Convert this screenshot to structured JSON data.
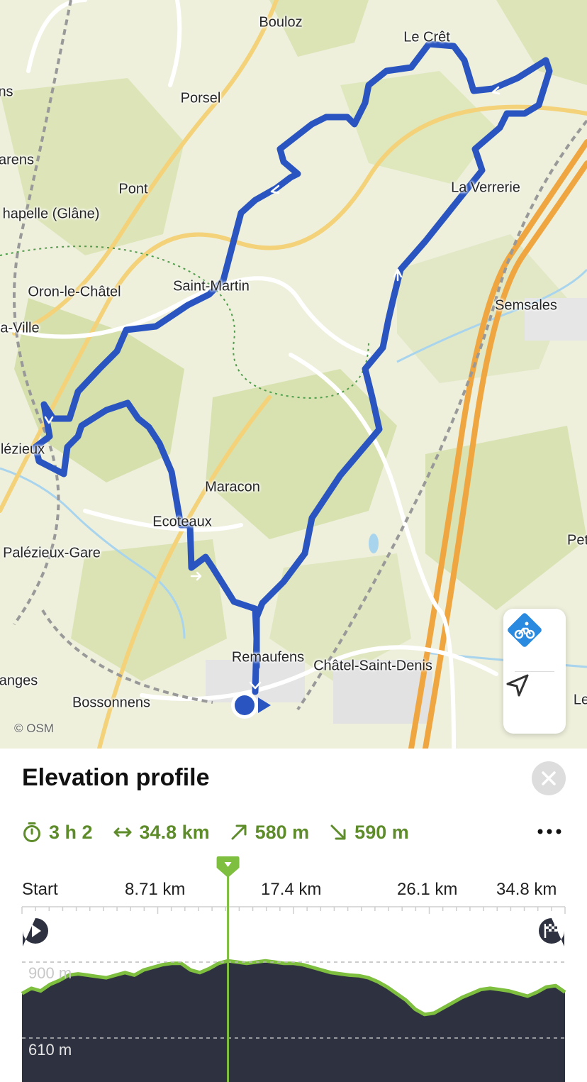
{
  "map": {
    "attribution": "© OSM",
    "places": [
      {
        "key": "bouloz",
        "label": "Bouloz"
      },
      {
        "key": "le-cret",
        "label": "Le Crêt"
      },
      {
        "key": "porsel",
        "label": "Porsel"
      },
      {
        "key": "ns",
        "label": "ns"
      },
      {
        "key": "arens",
        "label": "arens"
      },
      {
        "key": "pont",
        "label": "Pont"
      },
      {
        "key": "la-verrerie",
        "label": "La Verrerie"
      },
      {
        "key": "chapelle",
        "label": "hapelle (Glâne)"
      },
      {
        "key": "oron",
        "label": "Oron-le-Châtel"
      },
      {
        "key": "saint-martin",
        "label": "Saint-Martin"
      },
      {
        "key": "semsales",
        "label": "Semsales"
      },
      {
        "key": "ville",
        "label": "a-Ville"
      },
      {
        "key": "palezieux",
        "label": "lézieux"
      },
      {
        "key": "maracon",
        "label": "Maracon"
      },
      {
        "key": "ecoteaux",
        "label": "Ecoteaux"
      },
      {
        "key": "palezieux-gare",
        "label": "Palézieux-Gare"
      },
      {
        "key": "pet",
        "label": "Pet"
      },
      {
        "key": "remaufens",
        "label": "Remaufens"
      },
      {
        "key": "chatel",
        "label": "Châtel-Saint-Denis"
      },
      {
        "key": "anges",
        "label": "anges"
      },
      {
        "key": "bossonnens",
        "label": "Bossonnens"
      },
      {
        "key": "le",
        "label": "Le"
      }
    ],
    "controls": {
      "mode_icon": "bike-route-icon",
      "locate_icon": "location-arrow-icon"
    }
  },
  "panel": {
    "title": "Elevation profile",
    "stats": {
      "duration": "3 h 2",
      "distance": "34.8 km",
      "ascent": "580 m",
      "descent": "590 m"
    },
    "axis_labels": [
      "Start",
      "8.71 km",
      "17.4 km",
      "26.1 km",
      "34.8 km"
    ],
    "elevation_labels": [
      "900 m",
      "610 m"
    ]
  },
  "colors": {
    "route": "#2a55c0",
    "accent_green": "#5e8c2b",
    "profile_fill": "#2e3240",
    "profile_line": "#7fbf3f",
    "cursor": "#7fbf3f"
  },
  "chart_data": {
    "type": "area",
    "title": "Elevation profile",
    "xlabel": "",
    "ylabel": "",
    "x_ticks": [
      "Start",
      "8.71 km",
      "17.4 km",
      "26.1 km",
      "34.8 km"
    ],
    "y_ticks": [
      "900 m",
      "610 m"
    ],
    "xlim": [
      0,
      34.8
    ],
    "cursor_km": 13.2,
    "series": [
      {
        "x": [
          0,
          0.6,
          1.2,
          1.8,
          2.4,
          3.0,
          3.6,
          4.2,
          4.8,
          5.4,
          6.0,
          6.6,
          7.2,
          7.8,
          8.4,
          9.0,
          9.6,
          10.2,
          10.8,
          11.4,
          12.0,
          12.6,
          13.2,
          13.8,
          14.4,
          15.0,
          15.6,
          16.2,
          16.8,
          17.4,
          18.0,
          18.6,
          19.2,
          19.8,
          20.4,
          21.0,
          21.6,
          22.2,
          22.8,
          23.4,
          24.0,
          24.6,
          25.2,
          25.8,
          26.4,
          27.0,
          27.6,
          28.2,
          28.8,
          29.4,
          30.0,
          30.6,
          31.2,
          31.8,
          32.4,
          33.0,
          33.6,
          34.2,
          34.8
        ],
        "y": [
          780,
          800,
          790,
          815,
          830,
          850,
          855,
          850,
          845,
          840,
          850,
          860,
          850,
          870,
          880,
          890,
          895,
          895,
          870,
          860,
          875,
          895,
          905,
          900,
          895,
          900,
          905,
          900,
          895,
          895,
          890,
          880,
          870,
          860,
          855,
          850,
          848,
          840,
          825,
          805,
          780,
          755,
          720,
          700,
          705,
          725,
          745,
          765,
          780,
          795,
          800,
          795,
          790,
          780,
          770,
          785,
          805,
          810,
          785
        ]
      }
    ]
  }
}
